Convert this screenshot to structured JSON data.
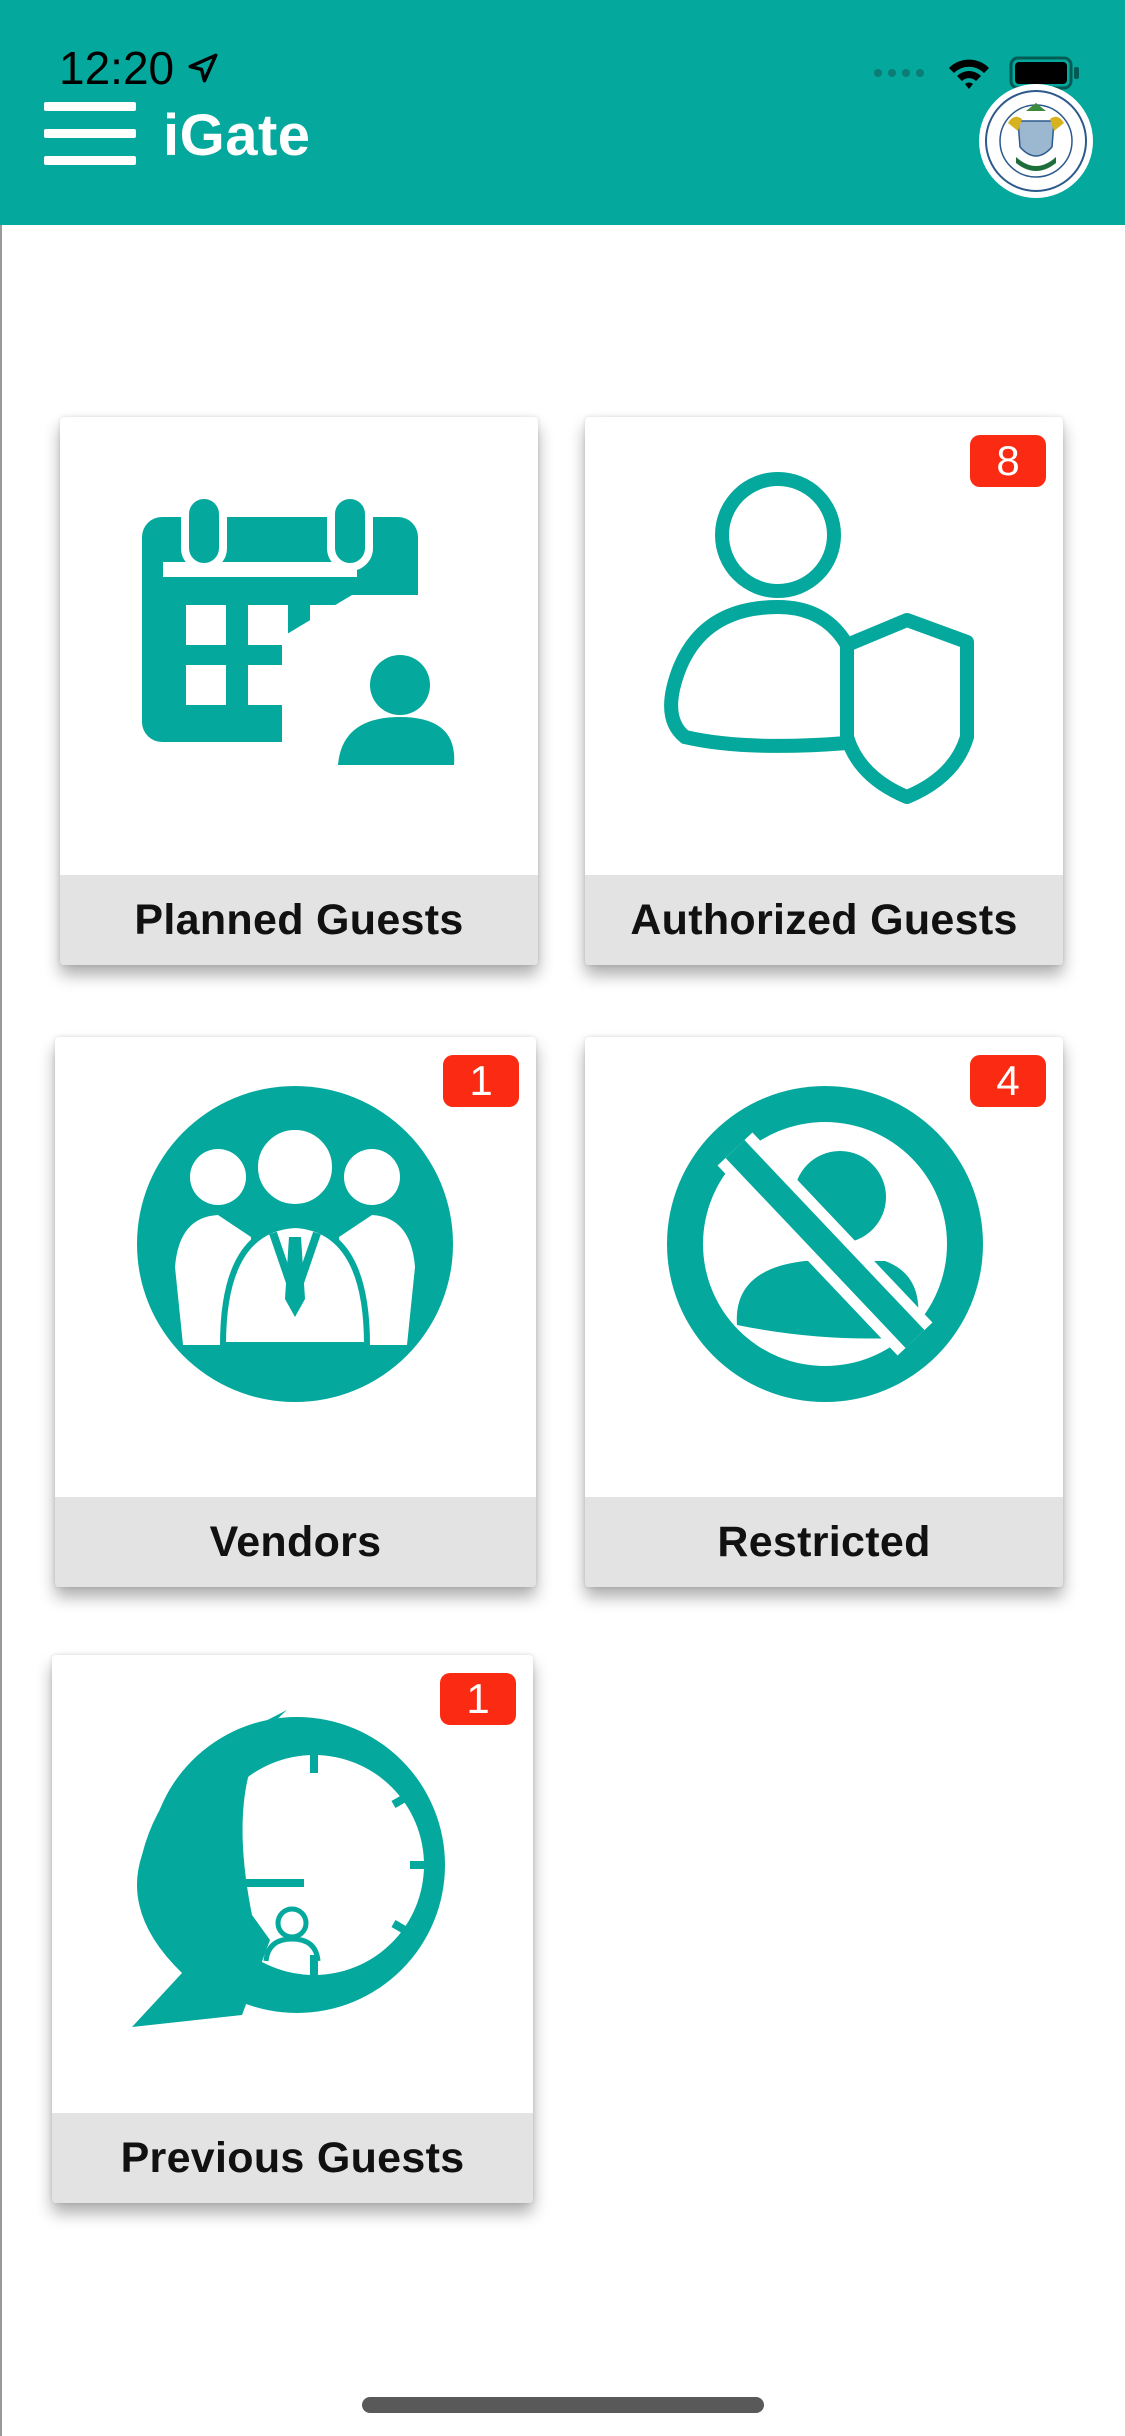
{
  "status_bar": {
    "time": "12:20"
  },
  "header": {
    "title": "iGate"
  },
  "colors": {
    "brand_teal": "#04A89C",
    "badge_red": "#FB2A12",
    "label_bg": "#E3E3E3"
  },
  "tiles": [
    {
      "label": "Planned Guests",
      "badge": "",
      "icon": "calendar-person-icon"
    },
    {
      "label": "Authorized Guests",
      "badge": "8",
      "icon": "user-shield-icon"
    },
    {
      "label": "Vendors",
      "badge": "1",
      "icon": "business-group-icon"
    },
    {
      "label": "Restricted",
      "badge": "4",
      "icon": "no-person-icon"
    },
    {
      "label": "Previous Guests",
      "badge": "1",
      "icon": "clock-history-icon"
    }
  ]
}
